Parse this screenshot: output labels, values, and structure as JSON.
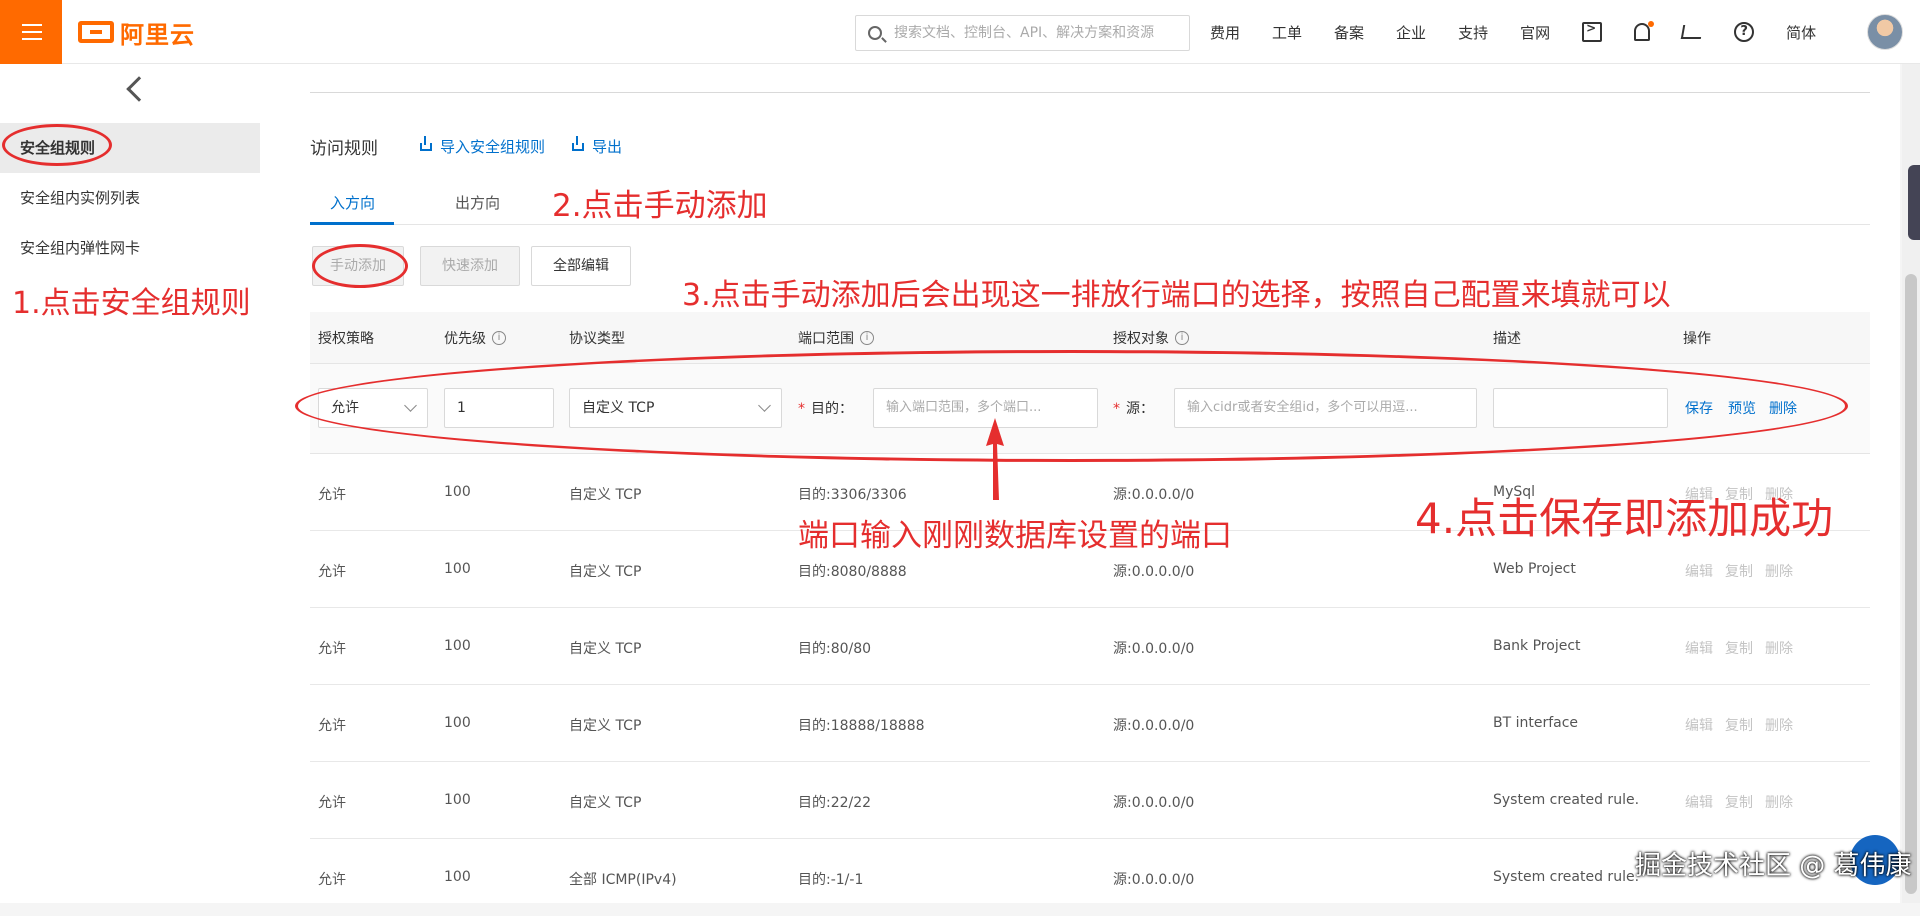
{
  "topbar": {
    "logo_text": "阿里云",
    "search_placeholder": "搜索文档、控制台、API、解决方案和资源",
    "nav": [
      "费用",
      "工单",
      "备案",
      "企业",
      "支持",
      "官网"
    ],
    "lang": "简体",
    "brand_color": "#ff6a00"
  },
  "sidebar": {
    "items": [
      {
        "label": "安全组规则"
      },
      {
        "label": "安全组内实例列表"
      },
      {
        "label": "安全组内弹性网卡"
      }
    ]
  },
  "main": {
    "section_title": "访问规则",
    "import_label": "导入安全组规则",
    "export_label": "导出",
    "tabs": [
      {
        "label": "入方向"
      },
      {
        "label": "出方向"
      }
    ],
    "buttons": {
      "manual_add": "手动添加",
      "quick_add": "快速添加",
      "edit_all": "全部编辑"
    },
    "columns": {
      "policy": "授权策略",
      "priority": "优先级",
      "protocol": "协议类型",
      "port_range": "端口范围",
      "auth_object": "授权对象",
      "description": "描述",
      "actions": "操作"
    },
    "edit_row": {
      "policy": "允许",
      "priority": "1",
      "protocol": "自定义 TCP",
      "dest_label": "目的：",
      "dest_placeholder": "输入端口范围，多个端口...",
      "source_label": "源：",
      "source_placeholder": "输入cidr或者安全组id，多个可以用逗...",
      "description": "",
      "save": "保存",
      "preview": "预览",
      "delete": "删除"
    },
    "rows": [
      {
        "policy": "允许",
        "priority": "100",
        "protocol": "自定义 TCP",
        "port": "目的:3306/3306",
        "source": "源:0.0.0.0/0",
        "desc": "MySql"
      },
      {
        "policy": "允许",
        "priority": "100",
        "protocol": "自定义 TCP",
        "port": "目的:8080/8888",
        "source": "源:0.0.0.0/0",
        "desc": "Web Project"
      },
      {
        "policy": "允许",
        "priority": "100",
        "protocol": "自定义 TCP",
        "port": "目的:80/80",
        "source": "源:0.0.0.0/0",
        "desc": "Bank Project"
      },
      {
        "policy": "允许",
        "priority": "100",
        "protocol": "自定义 TCP",
        "port": "目的:18888/18888",
        "source": "源:0.0.0.0/0",
        "desc": "BT interface"
      },
      {
        "policy": "允许",
        "priority": "100",
        "protocol": "自定义 TCP",
        "port": "目的:22/22",
        "source": "源:0.0.0.0/0",
        "desc": "System created rule."
      },
      {
        "policy": "允许",
        "priority": "100",
        "protocol": "全部 ICMP(IPv4)",
        "port": "目的:-1/-1",
        "source": "源:0.0.0.0/0",
        "desc": "System created rule."
      }
    ],
    "row_actions": {
      "edit": "编辑",
      "copy": "复制",
      "delete": "删除"
    }
  },
  "annotations": {
    "step1": "1.点击安全组规则",
    "step2": "2.点击手动添加",
    "step3": "3.点击手动添加后会出现这一排放行端口的选择，按照自己配置来填就可以",
    "port_note": "端口输入刚刚数据库设置的端口",
    "step4": "4.点击保存即添加成功",
    "color": "#e52e2e"
  },
  "watermark": "掘金技术社区 @ 葛伟康"
}
